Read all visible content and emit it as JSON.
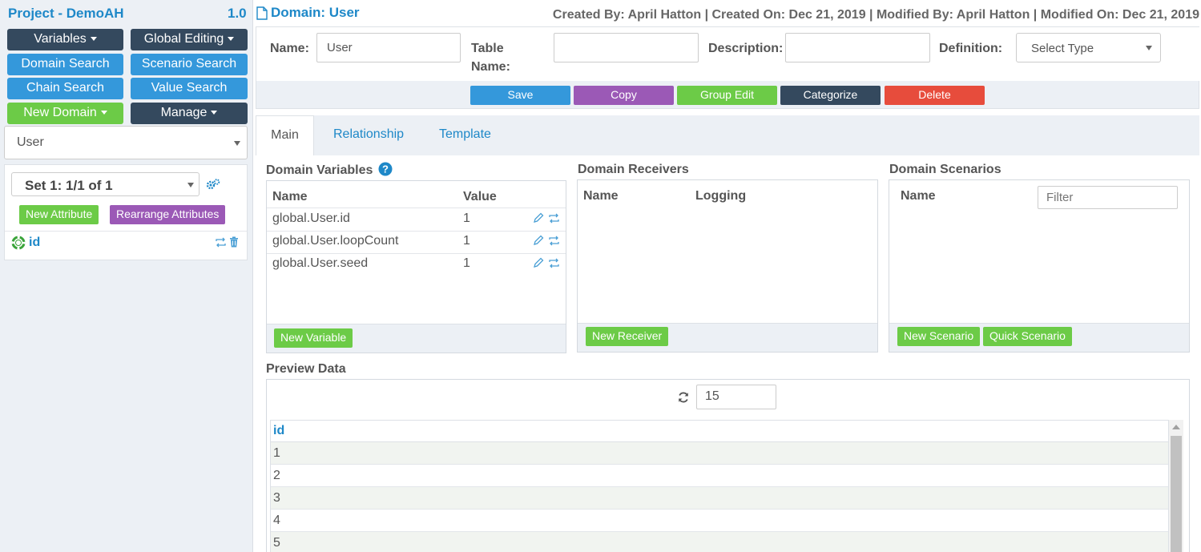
{
  "sidebar": {
    "project_title": "Project - DemoAH",
    "version": "1.0",
    "buttons": {
      "variables": "Variables",
      "global_editing": "Global Editing",
      "domain_search": "Domain Search",
      "scenario_search": "Scenario Search",
      "chain_search": "Chain Search",
      "value_search": "Value Search",
      "new_domain": "New Domain",
      "manage": "Manage"
    },
    "domain_select": "User",
    "set_select": "Set 1: 1/1 of 1",
    "new_attribute": "New Attribute",
    "rearrange_attributes": "Rearrange Attributes",
    "attributes": [
      {
        "name": "id"
      }
    ]
  },
  "header": {
    "domain_title": "Domain: User",
    "meta": "Created By: April Hatton | Created On: Dec 21, 2019 | Modified By: April Hatton | Modified On: Dec 21, 2019"
  },
  "form": {
    "name_label": "Name:",
    "name_value": "User",
    "table_name_label_1": "Table",
    "table_name_label_2": "Name:",
    "table_name_value": "",
    "description_label": "Description:",
    "description_value": "",
    "definition_label": "Definition:",
    "definition_value": "Select Type"
  },
  "actions": {
    "save": "Save",
    "copy": "Copy",
    "group_edit": "Group Edit",
    "categorize": "Categorize",
    "delete": "Delete"
  },
  "tabs": {
    "main": "Main",
    "relationship": "Relationship",
    "template": "Template"
  },
  "domain_variables": {
    "title": "Domain Variables",
    "col_name": "Name",
    "col_value": "Value",
    "rows": [
      {
        "name": "global.User.id",
        "value": "1"
      },
      {
        "name": "global.User.loopCount",
        "value": "1"
      },
      {
        "name": "global.User.seed",
        "value": "1"
      }
    ],
    "new_button": "New Variable"
  },
  "domain_receivers": {
    "title": "Domain Receivers",
    "col_name": "Name",
    "col_logging": "Logging",
    "new_button": "New Receiver"
  },
  "domain_scenarios": {
    "title": "Domain Scenarios",
    "col_name": "Name",
    "filter_placeholder": "Filter",
    "new_button": "New Scenario",
    "quick_button": "Quick Scenario"
  },
  "preview": {
    "title": "Preview Data",
    "count": "15",
    "column": "id",
    "rows": [
      "1",
      "2",
      "3",
      "4",
      "5"
    ]
  },
  "colors": {
    "accent_blue": "#1e88c8",
    "dark": "#34495e",
    "button_blue": "#3498db",
    "green": "#6ccb47",
    "purple": "#9b59b6",
    "red": "#e74c3c",
    "panel_bg": "#ecf0f5"
  }
}
